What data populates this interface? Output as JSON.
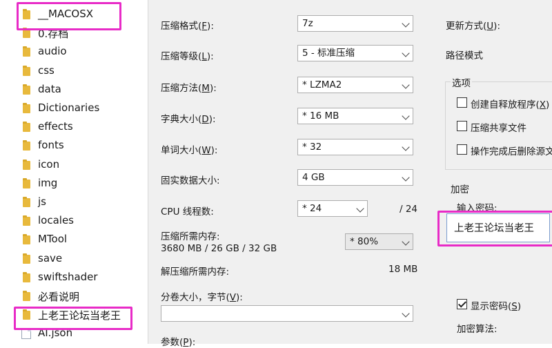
{
  "explorer": {
    "items": [
      {
        "label": "__MACOSX",
        "type": "folder"
      },
      {
        "label": "0.存档",
        "type": "folder"
      },
      {
        "label": "audio",
        "type": "folder"
      },
      {
        "label": "css",
        "type": "folder"
      },
      {
        "label": "data",
        "type": "folder"
      },
      {
        "label": "Dictionaries",
        "type": "folder"
      },
      {
        "label": "effects",
        "type": "folder"
      },
      {
        "label": "fonts",
        "type": "folder"
      },
      {
        "label": "icon",
        "type": "folder"
      },
      {
        "label": "img",
        "type": "folder"
      },
      {
        "label": "js",
        "type": "folder"
      },
      {
        "label": "locales",
        "type": "folder"
      },
      {
        "label": "MTool",
        "type": "folder"
      },
      {
        "label": "save",
        "type": "folder"
      },
      {
        "label": "swiftshader",
        "type": "folder"
      },
      {
        "label": "必看说明",
        "type": "folder"
      },
      {
        "label": "上老王论坛当老王",
        "type": "folder"
      },
      {
        "label": "AI.json",
        "type": "file"
      }
    ],
    "highlight_color": "#e82bc7"
  },
  "dialog": {
    "format": {
      "label_pre": "压缩格式(",
      "key": "F",
      "label_post": "):",
      "value": "7z"
    },
    "level": {
      "label_pre": "压缩等级(",
      "key": "L",
      "label_post": "):",
      "value": "5 - 标准压缩"
    },
    "method": {
      "label_pre": "压缩方法(",
      "key": "M",
      "label_post": "):",
      "value": "*  LZMA2"
    },
    "dict": {
      "label_pre": "字典大小(",
      "key": "D",
      "label_post": "):",
      "value": "*  16 MB"
    },
    "word": {
      "label_pre": "单词大小(",
      "key": "W",
      "label_post": "):",
      "value": "*  32"
    },
    "solid": {
      "label": "固实数据大小:",
      "value": "4 GB"
    },
    "threads": {
      "label": "CPU 线程数:",
      "value": "*  24",
      "total": "/ 24"
    },
    "mem": {
      "label": "压缩所需内存:",
      "detail": "3680 MB / 26 GB / 32 GB",
      "value": "* 80%"
    },
    "decomp": {
      "label": "解压缩所需内存:",
      "value": "18 MB"
    },
    "split": {
      "label_pre": "分卷大小，字节(",
      "key": "V",
      "label_post": "):"
    },
    "params": {
      "label_pre": "参数(",
      "key": "P",
      "label_post": "):"
    },
    "update": {
      "label_pre": "更新方式(",
      "key": "U",
      "label_post": "):"
    },
    "path_mode": "路径模式",
    "options": {
      "title": "选项",
      "sfx_pre": "创建自释放程序(",
      "sfx_key": "X",
      "sfx_post": ")",
      "shared": "压缩共享文件",
      "delete": "操作完成后删除源文"
    },
    "encryption": {
      "title": "加密",
      "pw_label": "输入密码:",
      "password": "上老王论坛当老王",
      "show_pre": "显示密码(",
      "show_key": "S",
      "show_post": ")",
      "method_label": "加密算法:",
      "show_checked": true
    }
  }
}
